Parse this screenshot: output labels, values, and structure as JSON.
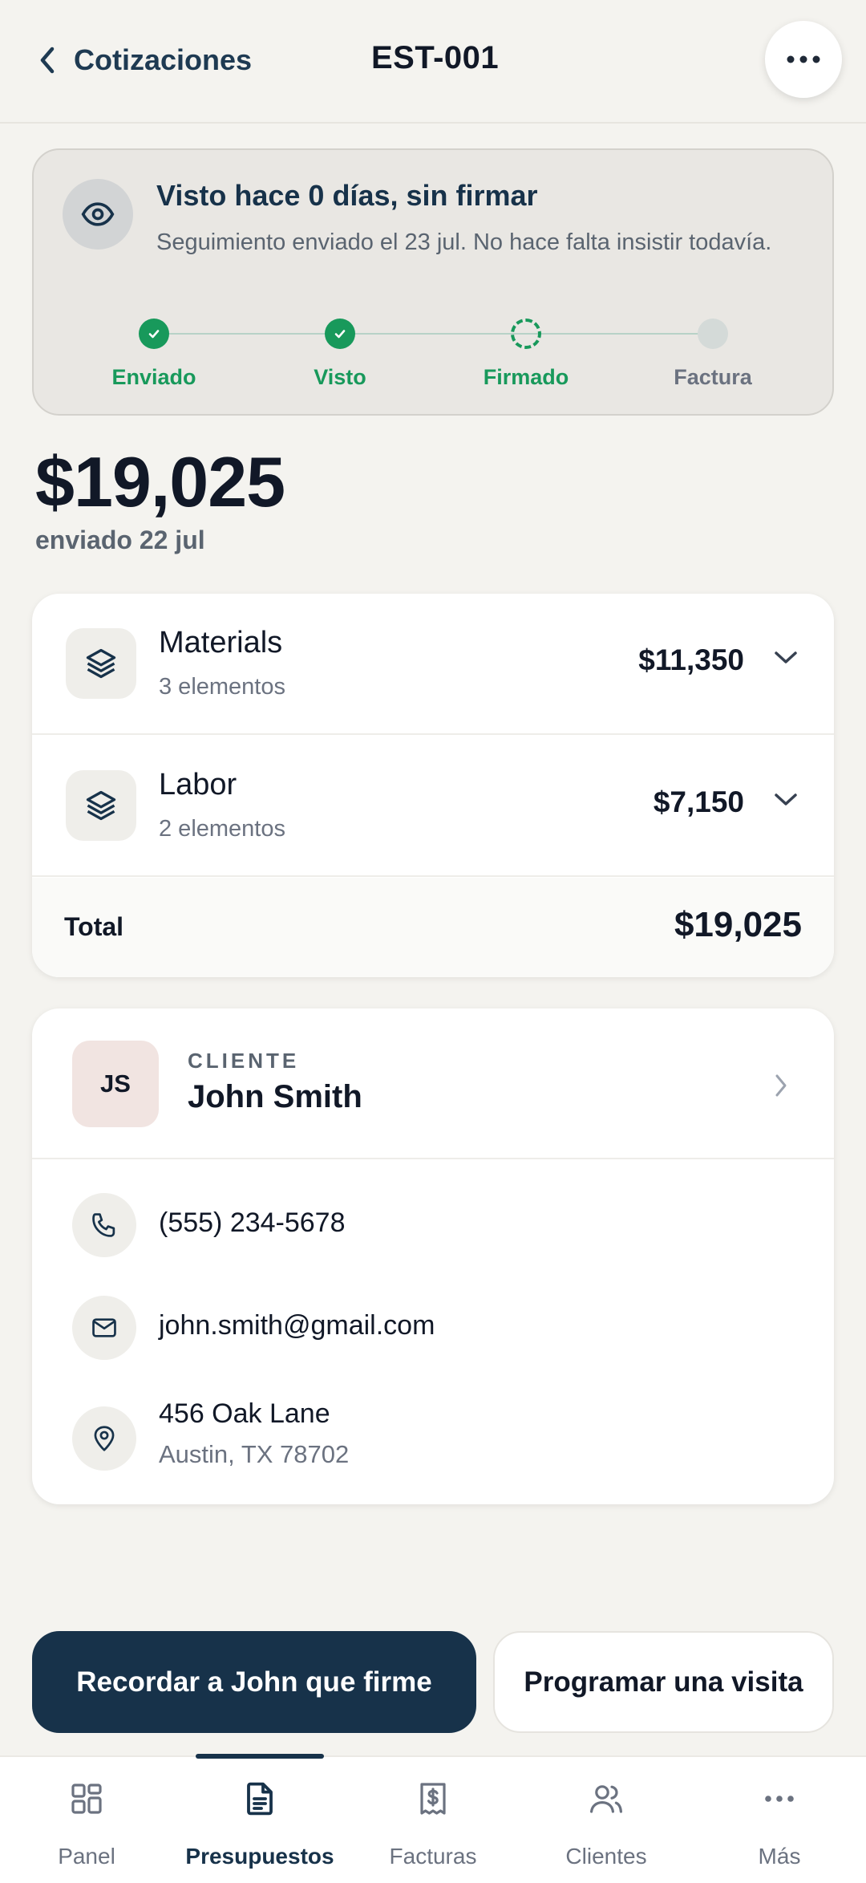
{
  "header": {
    "back_label": "Cotizaciones",
    "title": "EST-001"
  },
  "status": {
    "title": "Visto hace 0 días, sin firmar",
    "description": "Seguimiento enviado el 23 jul. No hace falta insistir todavía.",
    "steps": [
      {
        "label": "Enviado",
        "state": "done"
      },
      {
        "label": "Visto",
        "state": "done"
      },
      {
        "label": "Firmado",
        "state": "current"
      },
      {
        "label": "Factura",
        "state": "pending"
      }
    ]
  },
  "summary": {
    "amount": "$19,025",
    "sent": "enviado 22 jul"
  },
  "line_items": [
    {
      "name": "Materials",
      "count": "3 elementos",
      "price": "$11,350"
    },
    {
      "name": "Labor",
      "count": "2 elementos",
      "price": "$7,150"
    }
  ],
  "total": {
    "label": "Total",
    "value": "$19,025"
  },
  "client": {
    "kicker": "CLIENTE",
    "initials": "JS",
    "name": "John Smith",
    "phone": "(555) 234-5678",
    "email": "john.smith@gmail.com",
    "address_line1": "456 Oak Lane",
    "address_line2": "Austin, TX 78702"
  },
  "actions": {
    "primary": "Recordar a John que firme",
    "secondary": "Programar una visita"
  },
  "nav": {
    "items": [
      {
        "label": "Panel",
        "icon": "grid-icon"
      },
      {
        "label": "Presupuestos",
        "icon": "document-icon",
        "active": true
      },
      {
        "label": "Facturas",
        "icon": "invoice-icon"
      },
      {
        "label": "Clientes",
        "icon": "users-icon"
      },
      {
        "label": "Más",
        "icon": "more-icon"
      }
    ]
  },
  "colors": {
    "navy": "#17324a",
    "green": "#18995b",
    "background": "#f4f3ef"
  }
}
